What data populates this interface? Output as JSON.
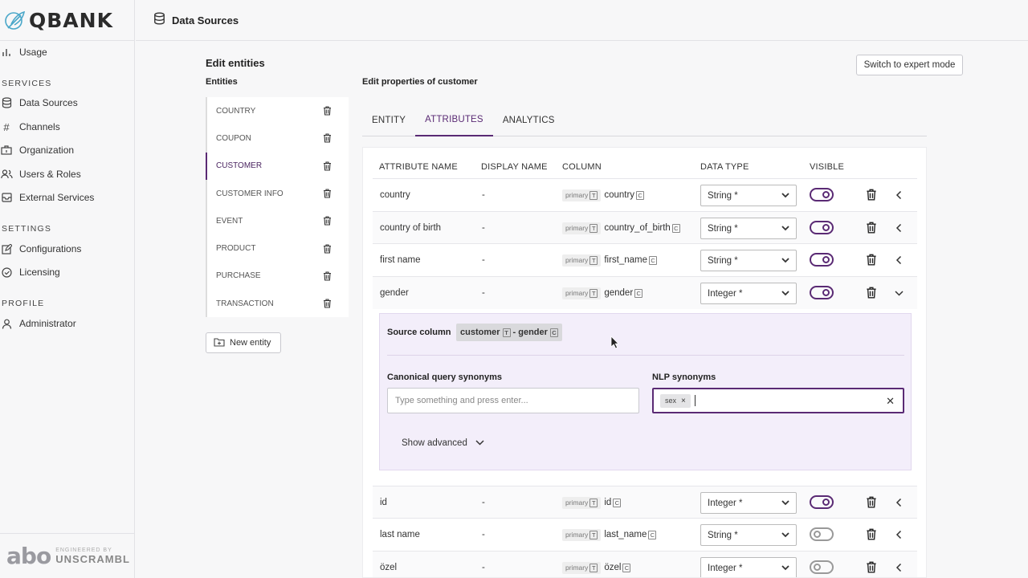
{
  "brand": {
    "logo": "QBANK",
    "footer_logo": "abo",
    "footer_engineered": "ENGINEERED BY",
    "footer_company": "UNSCRAMBL"
  },
  "sidebar": {
    "items_top": [
      {
        "label": "Usage",
        "icon": "bar-chart-icon"
      }
    ],
    "sections": [
      {
        "title": "SERVICES",
        "items": [
          {
            "label": "Data Sources",
            "icon": "database-icon"
          },
          {
            "label": "Channels",
            "icon": "hash-icon"
          },
          {
            "label": "Organization",
            "icon": "building-icon"
          },
          {
            "label": "Users & Roles",
            "icon": "users-icon"
          },
          {
            "label": "External Services",
            "icon": "inbox-icon"
          }
        ]
      },
      {
        "title": "SETTINGS",
        "items": [
          {
            "label": "Configurations",
            "icon": "edit-icon"
          },
          {
            "label": "Licensing",
            "icon": "check-circle-icon"
          }
        ]
      },
      {
        "title": "PROFILE",
        "items": [
          {
            "label": "Administrator",
            "icon": "user-icon"
          }
        ]
      }
    ]
  },
  "header": {
    "title": "Data Sources"
  },
  "entities_panel": {
    "heading": "Edit entities",
    "subheading": "Entities",
    "entities": [
      "COUNTRY",
      "COUPON",
      "CUSTOMER",
      "CUSTOMER INFO",
      "EVENT",
      "PRODUCT",
      "PURCHASE",
      "TRANSACTION"
    ],
    "active_entity": "CUSTOMER",
    "new_entity_label": "New entity"
  },
  "main": {
    "heading": "Edit properties of customer",
    "expert_mode_label": "Switch to expert mode",
    "tabs": [
      "ENTITY",
      "ATTRIBUTES",
      "ANALYTICS"
    ],
    "active_tab": "ATTRIBUTES",
    "columns": [
      "ATTRIBUTE NAME",
      "DISPLAY NAME",
      "COLUMN",
      "DATA TYPE",
      "VISIBLE"
    ],
    "rows_top": [
      {
        "name": "country",
        "display": "-",
        "prefix": "primary",
        "column": "country",
        "type": "String *",
        "visible": true
      },
      {
        "name": "country of birth",
        "display": "-",
        "prefix": "primary",
        "column": "country_of_birth",
        "type": "String *",
        "visible": true
      },
      {
        "name": "first name",
        "display": "-",
        "prefix": "primary",
        "column": "first_name",
        "type": "String *",
        "visible": true
      },
      {
        "name": "gender",
        "display": "-",
        "prefix": "primary",
        "column": "gender",
        "type": "Integer *",
        "visible": true
      }
    ],
    "rows_bottom": [
      {
        "name": "id",
        "display": "-",
        "prefix": "primary",
        "column": "id",
        "type": "Integer *",
        "visible": true
      },
      {
        "name": "last name",
        "display": "-",
        "prefix": "primary",
        "column": "last_name",
        "type": "String *",
        "visible": false
      },
      {
        "name": "özel",
        "display": "-",
        "prefix": "primary",
        "column": "özel",
        "type": "Integer *",
        "visible": false
      }
    ],
    "badges": {
      "table": "T",
      "column": "C"
    },
    "detail": {
      "source_label": "Source column",
      "source_table": "customer",
      "source_sep": "- gender",
      "canonical_label": "Canonical query synonyms",
      "canonical_placeholder": "Type something and press enter...",
      "nlp_label": "NLP synonyms",
      "nlp_tags": [
        "sex"
      ],
      "show_advanced_label": "Show advanced"
    }
  },
  "colors": {
    "accent": "#5a2a74",
    "detail_bg": "#f3eefa"
  }
}
